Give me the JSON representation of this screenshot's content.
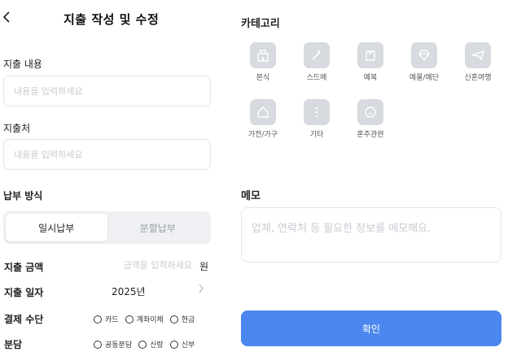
{
  "header": {
    "title": "지출 작성 및 수정",
    "back_icon": "chevron-left-icon"
  },
  "form": {
    "content_label": "지출 내용",
    "content_placeholder": "내용을 입력하세요",
    "vendor_label": "지출처",
    "vendor_placeholder": "내용을 입력하세요",
    "payment_method_label": "납부 방식",
    "payment_tabs": [
      {
        "label": "일시납부",
        "active": true
      },
      {
        "label": "분할납부",
        "active": false
      }
    ],
    "amount_label": "지출 금액",
    "amount_placeholder": "금액을 입력하세요",
    "amount_unit": "원",
    "date_label": "지출 일자",
    "date_value": "2025년",
    "pay_method_label": "결제 수단",
    "pay_methods": [
      "카드",
      "계좌이체",
      "현금"
    ],
    "share_label": "분담",
    "share_options": [
      "공동분담",
      "신랑",
      "신부"
    ]
  },
  "category": {
    "title": "카테고리",
    "items": [
      {
        "label": "본식",
        "icon": "building-icon"
      },
      {
        "label": "스드메",
        "icon": "magic-wand-icon"
      },
      {
        "label": "예복",
        "icon": "clothing-icon"
      },
      {
        "label": "예물/예단",
        "icon": "diamond-icon"
      },
      {
        "label": "신혼여행",
        "icon": "airplane-icon"
      },
      {
        "label": "가전/가구",
        "icon": "home-icon"
      },
      {
        "label": "기타",
        "icon": "more-icon"
      },
      {
        "label": "혼주관련",
        "icon": "smile-icon"
      }
    ]
  },
  "memo": {
    "title": "메모",
    "placeholder": "업체, 연락처 등 필요한 정보를 메모해요."
  },
  "actions": {
    "confirm_label": "확인"
  },
  "colors": {
    "primary": "#4b87ef",
    "icon_bg": "#d7dade",
    "border": "#e3e5ea",
    "placeholder": "#c8cbd1"
  }
}
